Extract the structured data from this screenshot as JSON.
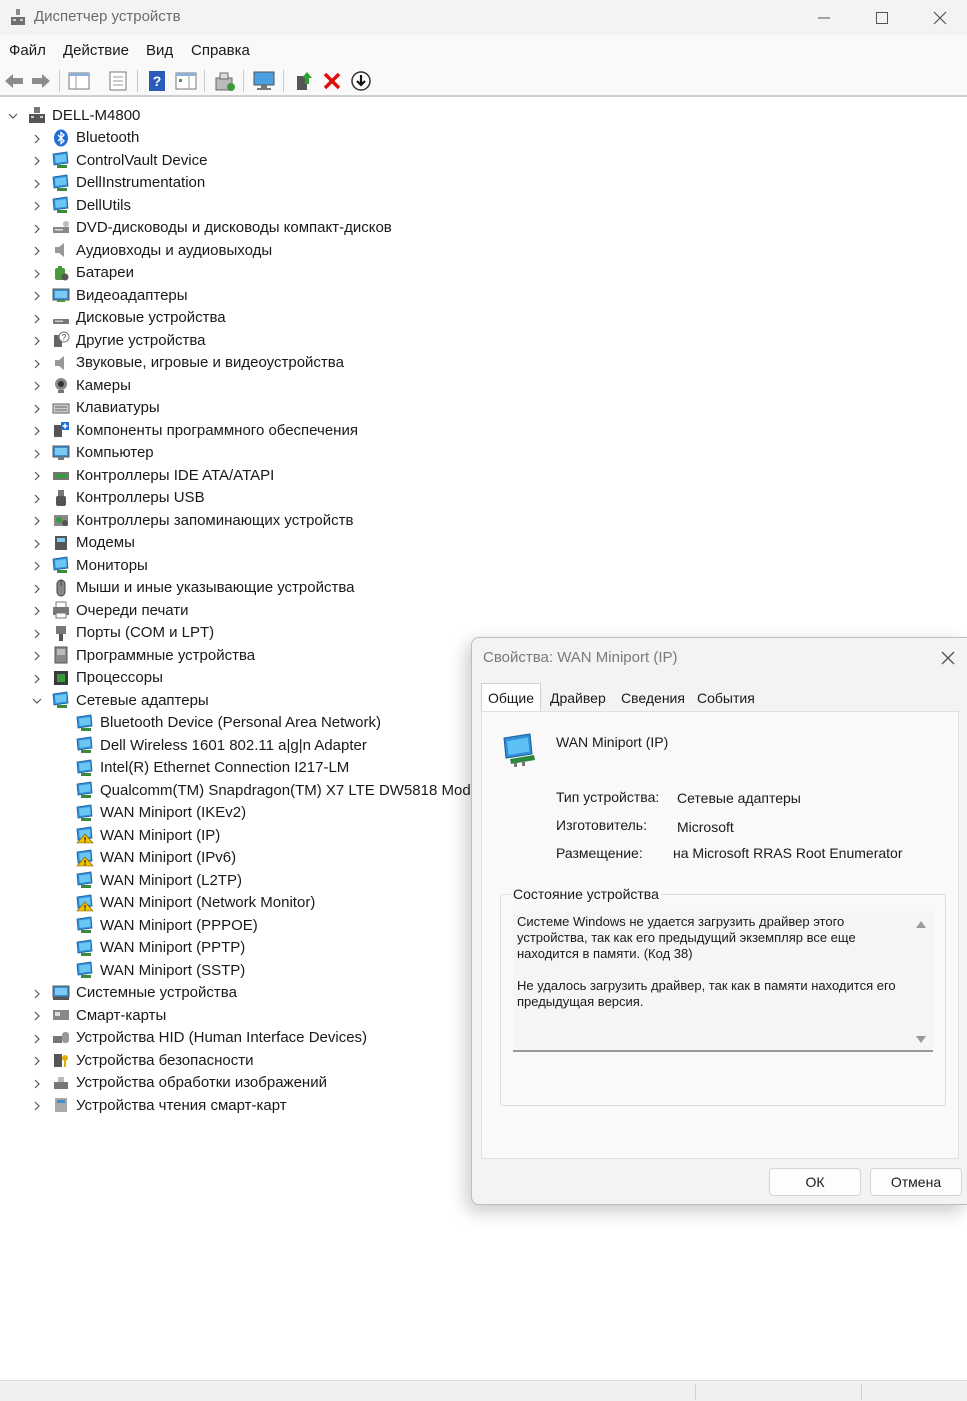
{
  "window": {
    "title": "Диспетчер устройств"
  },
  "menu": [
    "Файл",
    "Действие",
    "Вид",
    "Справка"
  ],
  "tree": {
    "root": "DELL-M4800",
    "categories": [
      {
        "label": "Bluetooth",
        "icon": "bluetooth-icon"
      },
      {
        "label": "ControlVault Device",
        "icon": "monitor-icon"
      },
      {
        "label": "DellInstrumentation",
        "icon": "monitor-icon"
      },
      {
        "label": "DellUtils",
        "icon": "monitor-icon"
      },
      {
        "label": "DVD-дисководы и дисководы компакт-дисков",
        "icon": "dvd-drive-icon"
      },
      {
        "label": "Аудиовходы и аудиовыходы",
        "icon": "speaker-icon"
      },
      {
        "label": "Батареи",
        "icon": "battery-icon"
      },
      {
        "label": "Видеоадаптеры",
        "icon": "display-adapter-icon"
      },
      {
        "label": "Дисковые устройства",
        "icon": "disk-drive-icon"
      },
      {
        "label": "Другие устройства",
        "icon": "unknown-device-icon"
      },
      {
        "label": "Звуковые, игровые и видеоустройства",
        "icon": "speaker-icon"
      },
      {
        "label": "Камеры",
        "icon": "camera-icon"
      },
      {
        "label": "Клавиатуры",
        "icon": "keyboard-icon"
      },
      {
        "label": "Компоненты программного обеспечения",
        "icon": "software-component-icon"
      },
      {
        "label": "Компьютер",
        "icon": "computer-icon"
      },
      {
        "label": "Контроллеры IDE ATA/ATAPI",
        "icon": "ide-controller-icon"
      },
      {
        "label": "Контроллеры USB",
        "icon": "usb-icon"
      },
      {
        "label": "Контроллеры запоминающих устройств",
        "icon": "storage-controller-icon"
      },
      {
        "label": "Модемы",
        "icon": "modem-icon"
      },
      {
        "label": "Мониторы",
        "icon": "monitor-icon"
      },
      {
        "label": "Мыши и иные указывающие устройства",
        "icon": "mouse-icon"
      },
      {
        "label": "Очереди печати",
        "icon": "printer-icon"
      },
      {
        "label": "Порты (COM и LPT)",
        "icon": "port-icon"
      },
      {
        "label": "Программные устройства",
        "icon": "software-device-icon"
      },
      {
        "label": "Процессоры",
        "icon": "processor-icon"
      },
      {
        "label": "Сетевые адаптеры",
        "icon": "network-adapter-icon",
        "expanded": true
      }
    ],
    "network_children": [
      {
        "label": "Bluetooth Device (Personal Area Network)",
        "warning": false
      },
      {
        "label": "Dell Wireless 1601 802.11 a|g|n Adapter",
        "warning": false
      },
      {
        "label": "Intel(R) Ethernet Connection I217-LM",
        "warning": false
      },
      {
        "label": "Qualcomm(TM) Snapdragon(TM) X7 LTE DW5818 Modem",
        "warning": false
      },
      {
        "label": "WAN Miniport (IKEv2)",
        "warning": false
      },
      {
        "label": "WAN Miniport (IP)",
        "warning": true
      },
      {
        "label": "WAN Miniport (IPv6)",
        "warning": true
      },
      {
        "label": "WAN Miniport (L2TP)",
        "warning": false
      },
      {
        "label": "WAN Miniport (Network Monitor)",
        "warning": true
      },
      {
        "label": "WAN Miniport (PPPOE)",
        "warning": false
      },
      {
        "label": "WAN Miniport (PPTP)",
        "warning": false
      },
      {
        "label": "WAN Miniport (SSTP)",
        "warning": false
      }
    ],
    "after_categories": [
      {
        "label": "Системные устройства",
        "icon": "system-device-icon"
      },
      {
        "label": "Смарт-карты",
        "icon": "smart-card-icon"
      },
      {
        "label": "Устройства HID (Human Interface Devices)",
        "icon": "hid-icon"
      },
      {
        "label": "Устройства безопасности",
        "icon": "security-device-icon"
      },
      {
        "label": "Устройства обработки изображений",
        "icon": "imaging-device-icon"
      },
      {
        "label": "Устройства чтения смарт-карт",
        "icon": "smart-card-reader-icon"
      }
    ]
  },
  "dialog": {
    "title": "Свойства: WAN Miniport (IP)",
    "tabs": [
      "Общие",
      "Драйвер",
      "Сведения",
      "События"
    ],
    "device_name": "WAN Miniport (IP)",
    "props": {
      "type_label": "Тип устройства:",
      "type_value": "Сетевые адаптеры",
      "mfr_label": "Изготовитель:",
      "mfr_value": "Microsoft",
      "loc_label": "Размещение:",
      "loc_value": "на Microsoft RRAS Root Enumerator"
    },
    "status_group_label": "Состояние устройства",
    "status_text_1": "Системе Windows не удается загрузить драйвер этого устройства, так как его предыдущий экземпляр все еще находится в памяти. (Код 38)",
    "status_text_2": "Не удалось загрузить драйвер, так как в памяти находится его предыдущая версия.",
    "ok_label": "ОК",
    "cancel_label": "Отмена"
  }
}
